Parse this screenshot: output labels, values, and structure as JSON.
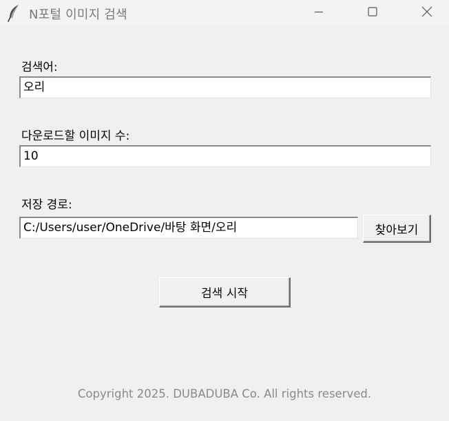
{
  "window": {
    "title": "N포털 이미지 검색"
  },
  "form": {
    "keyword_label": "검색어:",
    "keyword_value": "오리",
    "count_label": "다운로드할 이미지 수:",
    "count_value": "10",
    "path_label": "저장 경로:",
    "path_value": "C:/Users/user/OneDrive/바탕 화면/오리",
    "browse_label": "찾아보기",
    "start_label": "검색 시작"
  },
  "footer": {
    "copyright": "Copyright 2025. DUBADUBA Co. All rights reserved."
  },
  "icons": {
    "app": "feather-icon",
    "minimize": "minimize-icon",
    "maximize": "maximize-icon",
    "close": "close-icon"
  }
}
